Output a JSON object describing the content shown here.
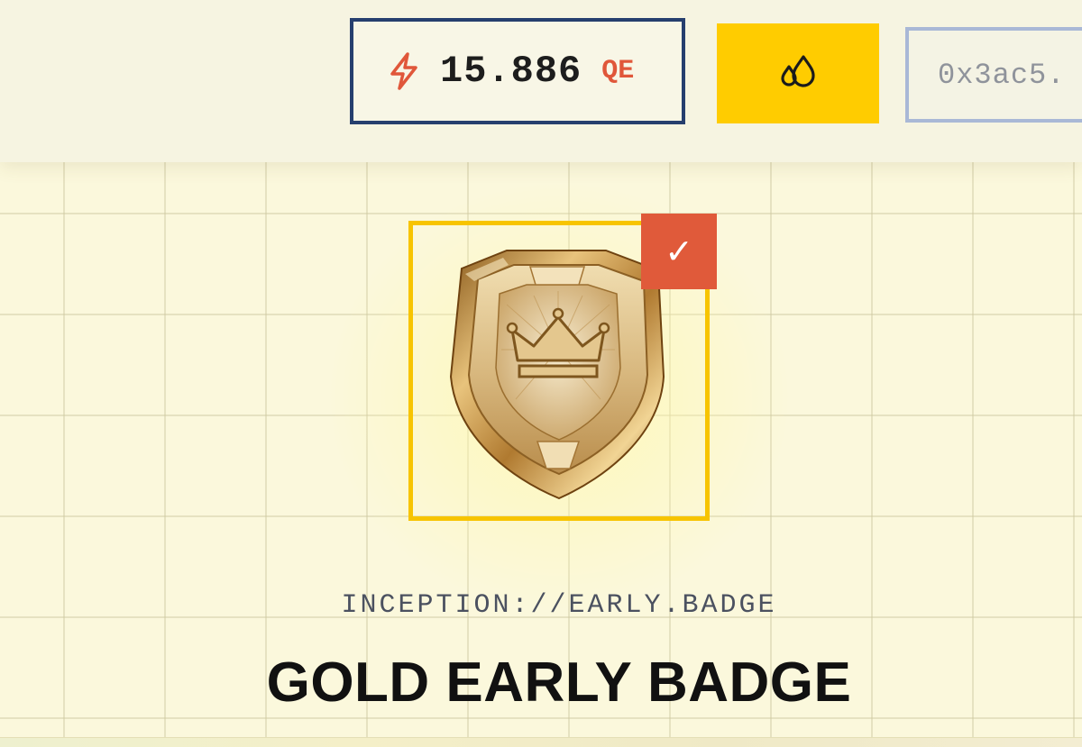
{
  "header": {
    "balance": {
      "icon": "lightning-icon",
      "value": "15.886",
      "unit": "QE"
    },
    "faucet_button": {
      "icon": "droplets-icon"
    },
    "wallet": {
      "address": "0x3ac5."
    }
  },
  "badge": {
    "image": "gold-shield-crown-badge",
    "selected_icon": "check-icon",
    "selected_glyph": "✓",
    "identifier": "INCEPTION://EARLY.BADGE",
    "title": "GOLD EARLY BADGE"
  },
  "colors": {
    "accent_yellow": "#ffcc00",
    "accent_orange": "#e05a3a",
    "navy_border": "#263f6e",
    "background": "#fbf8dc"
  }
}
